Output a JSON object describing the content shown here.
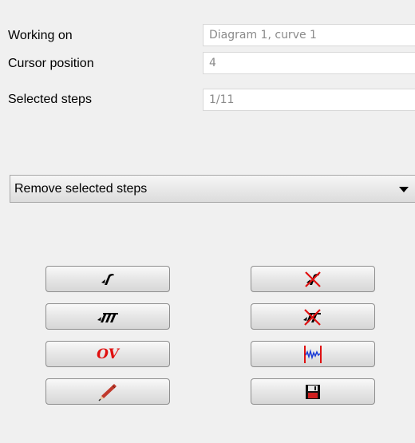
{
  "info": {
    "working_on": {
      "label": "Working on",
      "value": "Diagram 1, curve 1"
    },
    "cursor_position": {
      "label": "Cursor position",
      "value": "4"
    },
    "selected_steps": {
      "label": "Selected steps",
      "value": "1/11"
    }
  },
  "action_select": {
    "value": "Remove selected steps"
  },
  "buttons": {
    "left": [
      {
        "icon": "single-step-icon"
      },
      {
        "icon": "multi-step-icon"
      },
      {
        "icon": "ov-icon",
        "text": "OV"
      },
      {
        "icon": "pencil-icon"
      }
    ],
    "right": [
      {
        "icon": "remove-step-icon"
      },
      {
        "icon": "remove-multi-step-icon"
      },
      {
        "icon": "waveform-range-icon"
      },
      {
        "icon": "save-icon"
      }
    ]
  },
  "colors": {
    "accent_red": "#e01010",
    "accent_blue": "#1a3bd6"
  }
}
